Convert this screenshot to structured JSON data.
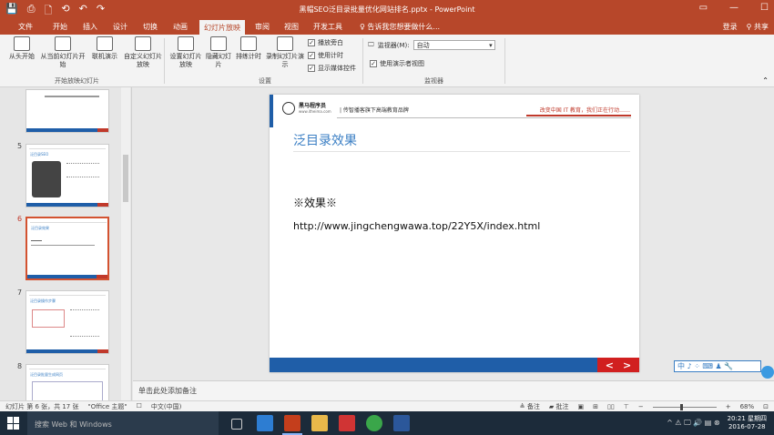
{
  "titlebar": {
    "title": "黑帽SEO泛目录批量优化网站排名.pptx - PowerPoint",
    "qat": [
      "💾",
      "⎙",
      "🗋",
      "⟲",
      "↶",
      "↷"
    ],
    "winctl": [
      "▭",
      "—",
      "☐"
    ]
  },
  "tabs": {
    "items": [
      "文件",
      "开始",
      "插入",
      "设计",
      "切换",
      "动画",
      "幻灯片放映",
      "审阅",
      "视图",
      "开发工具"
    ],
    "active": "幻灯片放映",
    "tellme": "告诉我您想要做什么...",
    "login": "登录",
    "share": "共享"
  },
  "ribbon": {
    "start_group": {
      "name": "开始放映幻灯片",
      "buttons": [
        "从头开始",
        "从当前幻灯片开始",
        "联机演示",
        "自定义幻灯片放映"
      ]
    },
    "setup_group": {
      "name": "设置",
      "buttons": [
        "设置幻灯片放映",
        "隐藏幻灯片",
        "排练计时",
        "录制幻灯片演示"
      ],
      "checks": [
        {
          "label": "播放旁白",
          "checked": true
        },
        {
          "label": "使用计时",
          "checked": true
        },
        {
          "label": "显示媒体控件",
          "checked": true
        }
      ]
    },
    "monitor_group": {
      "name": "监视器",
      "monitor_label": "监视器(M):",
      "monitor_value": "自动",
      "presenter_view": "使用演示者视图",
      "presenter_checked": true
    }
  },
  "thumbnails": [
    {
      "num": "",
      "title": "",
      "selected": false
    },
    {
      "num": "5",
      "title": "泛目录SEO",
      "selected": false
    },
    {
      "num": "6",
      "title": "泛目录效果",
      "selected": true
    },
    {
      "num": "7",
      "title": "泛目录操作步骤",
      "selected": false
    },
    {
      "num": "8",
      "title": "泛目录批量生成网页",
      "selected": false
    }
  ],
  "slide": {
    "brand": "黑马程序员",
    "brand_url": "www.itheima.com",
    "tagline": "| 传智播客旗下高端教育品牌",
    "slogan": "改变中国 IT 教育，我们正在行动……",
    "title": "泛目录效果",
    "effect": "※效果※",
    "link": "http://www.jingchengwawa.top/22Y5X/index.html",
    "nav_prev": "<",
    "nav_next": ">"
  },
  "ime": "中 ♪ ⁘ ⌨ ♟ 🔧",
  "notes": {
    "placeholder": "单击此处添加备注"
  },
  "statusbar": {
    "slide_info": "幻灯片 第 6 张，共 17 张",
    "theme": "\"Office 主题\"",
    "language": "中文(中国)",
    "notes_btn": "≜ 备注",
    "comments_btn": "▰ 批注",
    "zoom": "68%"
  },
  "taskbar": {
    "search": "搜索 Web 和 Windows",
    "time": "20:21 星期四",
    "date": "2016-07-28",
    "tray": "^ ⚠ 🖵 🔊 ▤ ⊗"
  },
  "colors": {
    "ppt_red": "#b7472a",
    "slide_blue": "#1f5ea8",
    "accent_red": "#d11f1f"
  }
}
